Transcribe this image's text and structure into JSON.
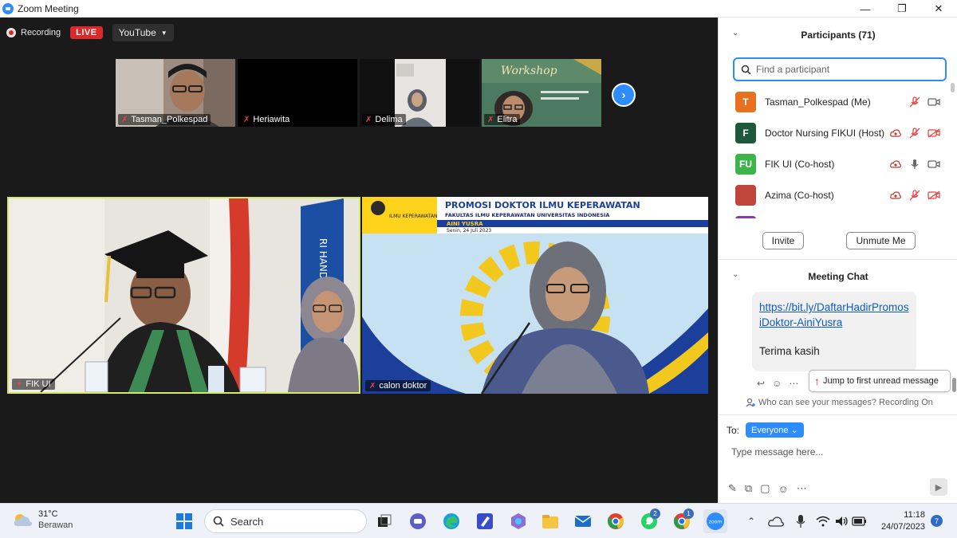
{
  "window": {
    "title": "Zoom Meeting",
    "minimize": "—",
    "maximize": "❐",
    "close": "✕"
  },
  "recording": {
    "label": "Recording",
    "live_badge": "LIVE",
    "stream_target": "YouTube"
  },
  "gallery": {
    "thumbnails": [
      {
        "name": "Tasman_Polkespad"
      },
      {
        "name": "Heriawita"
      },
      {
        "name": "Delima"
      },
      {
        "name": "Elitra",
        "image_title": "Workshop"
      }
    ]
  },
  "main_videos": [
    {
      "name": "FIK UI",
      "flag_text": "RI HANDA"
    },
    {
      "name": "calon doktor",
      "banner_title": "PROMOSI DOKTOR ILMU KEPERAWATAN",
      "banner_subtitle": "FAKULTAS ILMU KEPERAWATAN UNIVERSITAS INDONESIA",
      "banner_name": "AINI YUSRA",
      "banner_date": "Senin, 24 Juli 2023",
      "logo_text": "ILMU KEPERAWATAN"
    }
  ],
  "participants": {
    "header": "Participants (71)",
    "search_placeholder": "Find a participant",
    "list": [
      {
        "initials": "T",
        "name": "Tasman_Polkespad (Me)",
        "color": "#e8711f"
      },
      {
        "initials": "F",
        "name": "Doctor Nursing FIKUI (Host)",
        "color": "#1e5a3a"
      },
      {
        "initials": "FU",
        "name": "FIK UI (Co-host)",
        "color": "#3cb44a"
      },
      {
        "initials": "",
        "name": "Azima (Co-host)",
        "color": "#c0463c"
      }
    ],
    "invite_label": "Invite",
    "unmute_label": "Unmute Me"
  },
  "chat": {
    "header": "Meeting Chat",
    "link": "https://bit.ly/DaftarHadirPromosiDoktor-AiniYusra",
    "message": "Terima kasih",
    "jump_label": "Jump to first unread message",
    "privacy_note": "Who can see your messages? Recording On",
    "to_label": "To:",
    "recipient": "Everyone",
    "input_placeholder": "Type message here..."
  },
  "taskbar": {
    "weather_temp": "31°C",
    "weather_desc": "Berawan",
    "search_label": "Search",
    "whatsapp_badge": "2",
    "chrome_badge": "1",
    "zoom_label": "zoom",
    "time": "11:18",
    "date": "24/07/2023",
    "notification_count": "7"
  },
  "colors": {
    "zoom_blue": "#2d8cff",
    "live_red": "#d82a2a",
    "mute_red": "#e84444",
    "active_speaker": "#d4e86a"
  }
}
